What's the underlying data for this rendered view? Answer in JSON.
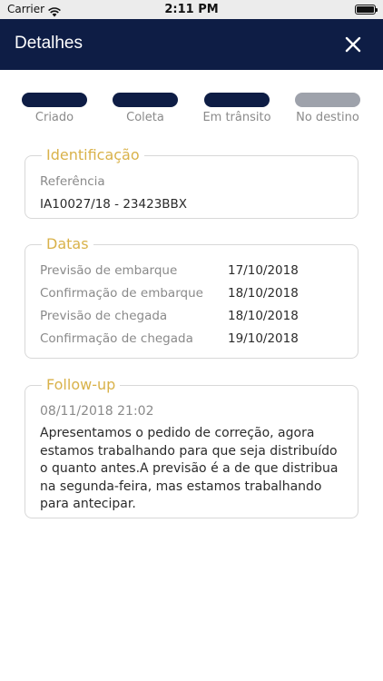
{
  "status_bar": {
    "carrier": "Carrier",
    "time": "2:11 PM"
  },
  "header": {
    "title": "Detalhes",
    "close_icon": "close-icon"
  },
  "steps": [
    {
      "label": "Criado",
      "done": true
    },
    {
      "label": "Coleta",
      "done": true
    },
    {
      "label": "Em trânsito",
      "done": true
    },
    {
      "label": "No destino",
      "done": false
    }
  ],
  "identificacao": {
    "title": "Identificação",
    "reference_label": "Referência",
    "reference_value": "IA10027/18 - 23423BBX"
  },
  "datas": {
    "title": "Datas",
    "rows": [
      {
        "label": "Previsão de embarque",
        "value": "17/10/2018"
      },
      {
        "label": "Confirmação de embarque",
        "value": "18/10/2018"
      },
      {
        "label": "Previsão de chegada",
        "value": "18/10/2018"
      },
      {
        "label": "Confirmação de chegada",
        "value": "19/10/2018"
      }
    ]
  },
  "followup": {
    "title": "Follow-up",
    "timestamp": "08/11/2018 21:02",
    "text": "Apresentamos o pedido de correção, agora estamos trabalhando para que seja distribuído o quanto antes.A previsão é a de que distribua na segunda-feira, mas estamos trabalhando para antecipar."
  },
  "colors": {
    "navy": "#0e1d45",
    "accent_gold": "#d9b24a",
    "inactive_step": "#9ea2ab"
  }
}
